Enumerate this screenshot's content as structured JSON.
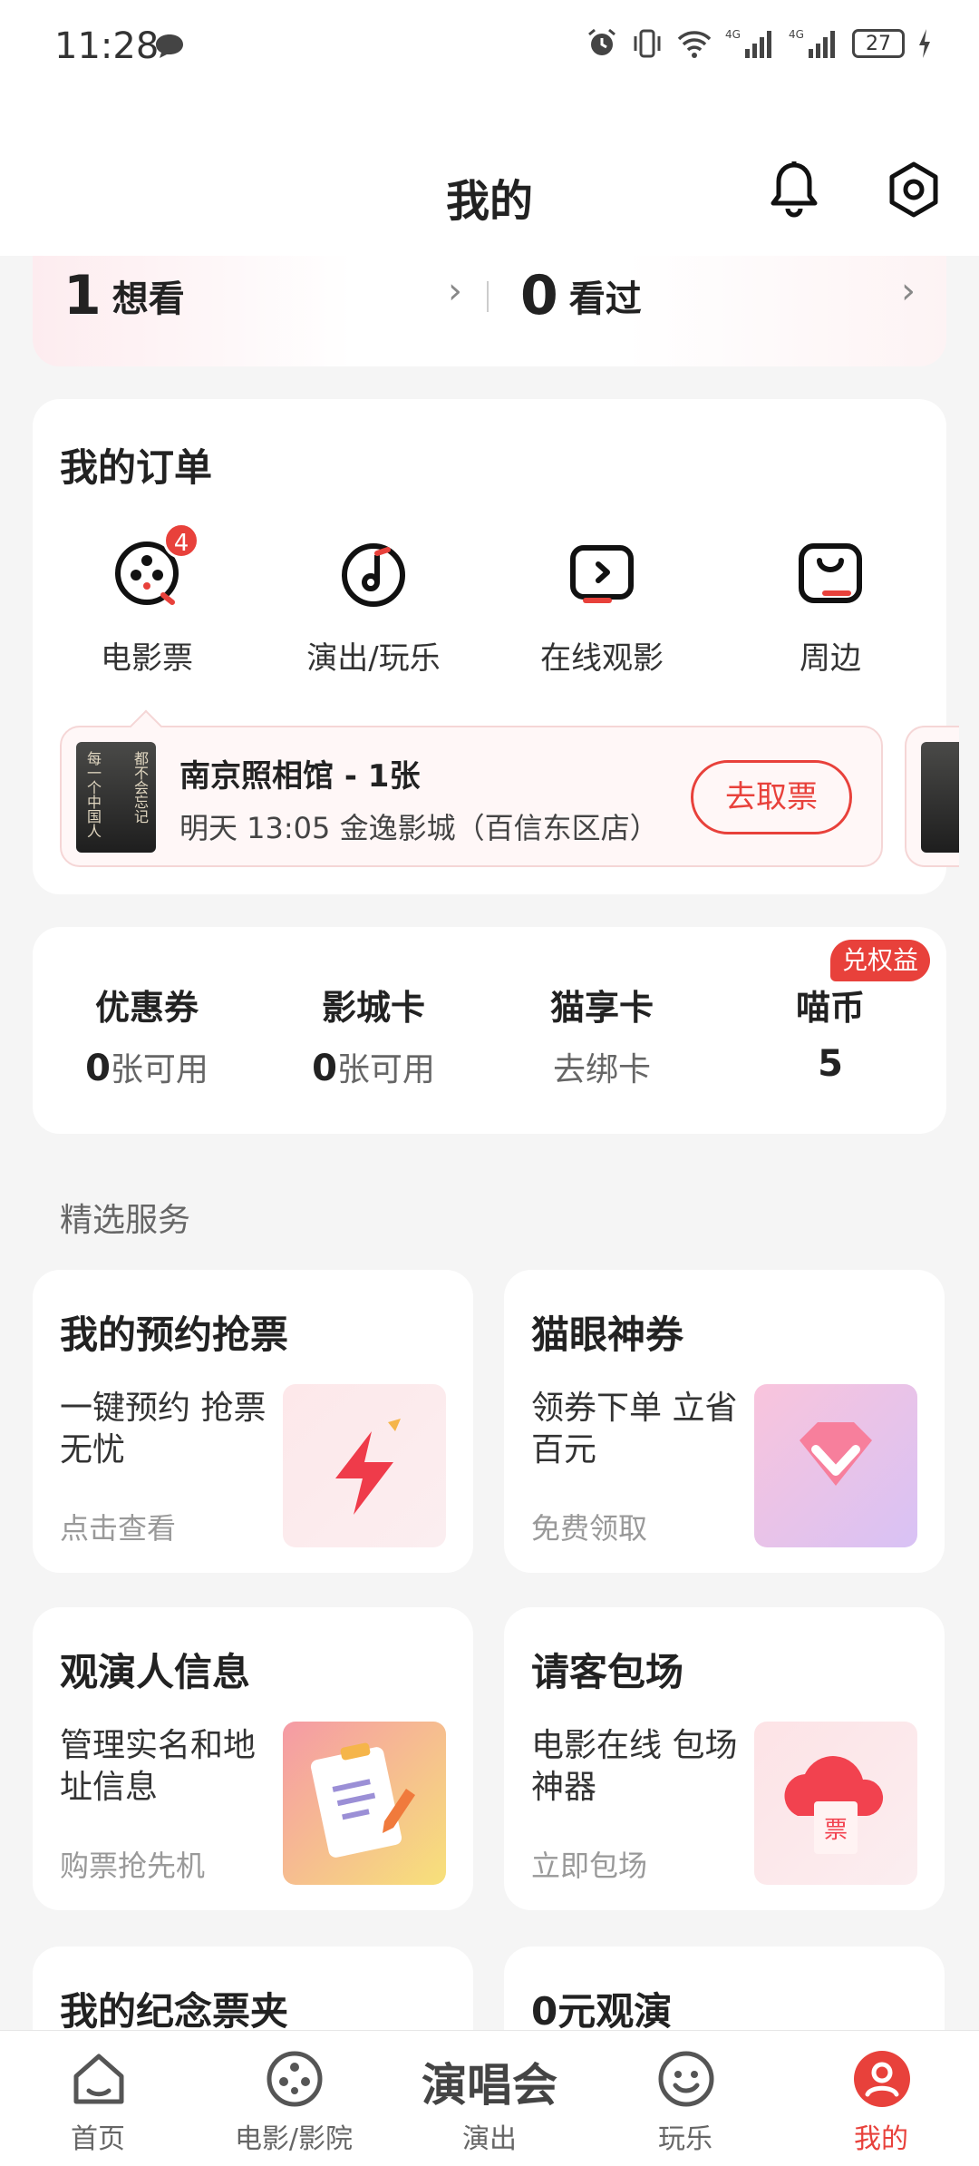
{
  "status_bar": {
    "time": "11:28",
    "battery": "27"
  },
  "header": {
    "title": "我的"
  },
  "watch": {
    "want_count": "1",
    "want_label": "想看",
    "watched_count": "0",
    "watched_label": "看过"
  },
  "orders": {
    "title": "我的订单",
    "items": [
      {
        "label": "电影票",
        "badge": "4",
        "icon": "film-reel-icon"
      },
      {
        "label": "演出/玩乐",
        "icon": "music-note-icon"
      },
      {
        "label": "在线观影",
        "icon": "play-screen-icon"
      },
      {
        "label": "周边",
        "icon": "shopping-bag-icon"
      }
    ],
    "ticket": {
      "title": "南京照相馆 - 1张",
      "subtitle": "明天 13:05 金逸影城（百信东区店）",
      "action": "去取票",
      "poster_text_left": "每一个中国人",
      "poster_text_right": "都不会忘记"
    }
  },
  "assets": {
    "items": [
      {
        "title": "优惠券",
        "value_num": "0",
        "value_unit": "张可用"
      },
      {
        "title": "影城卡",
        "value_num": "0",
        "value_unit": "张可用"
      },
      {
        "title": "猫享卡",
        "value_num": "",
        "value_unit": "去绑卡"
      },
      {
        "title": "喵币",
        "value_num": "5",
        "value_unit": ""
      }
    ],
    "redeem_badge": "兑权益"
  },
  "services": {
    "title": "精选服务",
    "cards": [
      {
        "title": "我的预约抢票",
        "desc": "一键预约 抢票无忧",
        "sub": "点击查看",
        "icon": "lightning-icon"
      },
      {
        "title": "猫眼神券",
        "desc": "领券下单 立省百元",
        "sub": "免费领取",
        "icon": "diamond-coupon-icon"
      },
      {
        "title": "观演人信息",
        "desc": "管理实名和地址信息",
        "sub": "购票抢先机",
        "icon": "clipboard-pencil-icon"
      },
      {
        "title": "请客包场",
        "desc": "电影在线 包场神器",
        "sub": "立即包场",
        "icon": "cloud-ticket-icon"
      },
      {
        "title": "我的纪念票夹"
      },
      {
        "title": "0元观演"
      }
    ]
  },
  "tabbar": {
    "items": [
      {
        "label": "首页",
        "icon": "home-icon"
      },
      {
        "label": "电影/影院",
        "icon": "film-reel-icon"
      },
      {
        "label": "演出",
        "badge_text": "演唱会"
      },
      {
        "label": "玩乐",
        "icon": "smile-icon"
      },
      {
        "label": "我的",
        "icon": "profile-icon"
      }
    ]
  },
  "colors": {
    "accent": "#e8413b",
    "background": "#f5f5f5"
  }
}
